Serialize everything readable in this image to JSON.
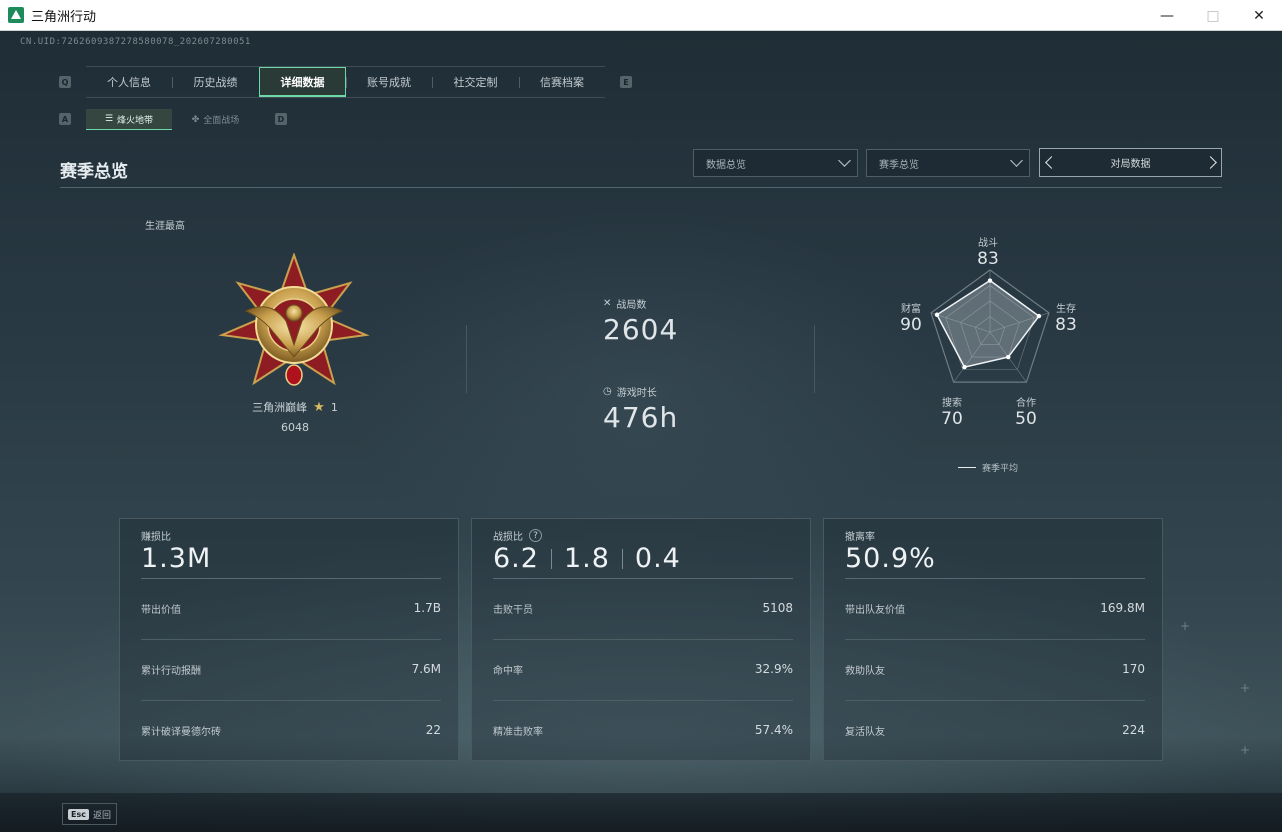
{
  "window": {
    "title": "三角洲行动"
  },
  "header": {
    "uid": "CN.UID:7262609387278580078_202607280051"
  },
  "tabs": {
    "left_key": "Q",
    "right_key": "E",
    "items": [
      {
        "label": "个人信息"
      },
      {
        "label": "历史战绩"
      },
      {
        "label": "详细数据"
      },
      {
        "label": "账号成就"
      },
      {
        "label": "社交定制"
      },
      {
        "label": "信赛档案"
      }
    ],
    "active_index": 2
  },
  "subtabs": {
    "left_key": "A",
    "right_key": "D",
    "items": [
      {
        "label": "烽火地带"
      },
      {
        "label": "全面战场"
      }
    ],
    "active_index": 0
  },
  "section": {
    "title": "赛季总览",
    "dropdown_1": "数据总览",
    "dropdown_2": "赛季总览",
    "pager_label": "对局数据"
  },
  "career": {
    "label": "生涯最高",
    "rank_name": "三角洲巅峰",
    "rank_stars": "1",
    "rank_score": "6048"
  },
  "stats": {
    "matches_label": "战局数",
    "matches_value": "2604",
    "playtime_label": "游戏时长",
    "playtime_value": "476h"
  },
  "radar": {
    "axes": [
      {
        "label": "战斗",
        "value": "83"
      },
      {
        "label": "生存",
        "value": "83"
      },
      {
        "label": "合作",
        "value": "50"
      },
      {
        "label": "搜索",
        "value": "70"
      },
      {
        "label": "财富",
        "value": "90"
      }
    ],
    "values": [
      83,
      83,
      50,
      70,
      90
    ],
    "legend": "赛季平均"
  },
  "cards": [
    {
      "title": "赚损比",
      "value": "1.3M",
      "rows": [
        {
          "label": "带出价值",
          "value": "1.7B"
        },
        {
          "label": "累计行动报酬",
          "value": "7.6M"
        },
        {
          "label": "累计破译曼德尔砖",
          "value": "22"
        }
      ]
    },
    {
      "title": "战损比",
      "values": [
        "6.2",
        "1.8",
        "0.4"
      ],
      "rows": [
        {
          "label": "击败干员",
          "value": "5108"
        },
        {
          "label": "命中率",
          "value": "32.9%"
        },
        {
          "label": "精准击败率",
          "value": "57.4%"
        }
      ]
    },
    {
      "title": "撤离率",
      "value": "50.9%",
      "rows": [
        {
          "label": "带出队友价值",
          "value": "169.8M"
        },
        {
          "label": "救助队友",
          "value": "170"
        },
        {
          "label": "复活队友",
          "value": "224"
        }
      ]
    }
  ],
  "footer": {
    "esc_key": "Esc",
    "esc_label": "返回"
  },
  "colors": {
    "accent": "#6dd9a6",
    "gold": "#d8b964"
  }
}
